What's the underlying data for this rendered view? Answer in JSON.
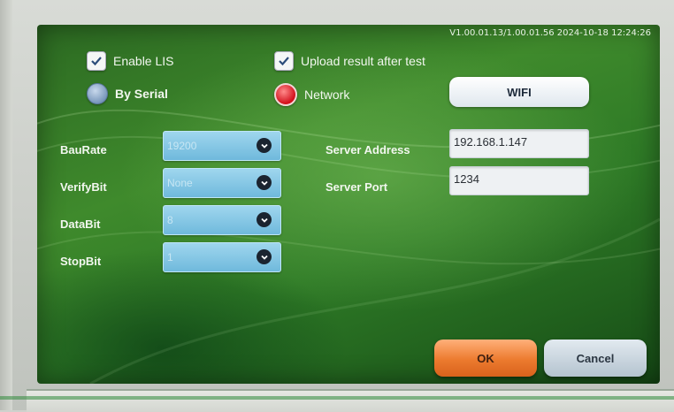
{
  "version_info": "V1.00.01.13/1.00.01.56  2024-10-18 12:24:26",
  "options": {
    "enable_lis": {
      "label": "Enable LIS",
      "checked": true
    },
    "upload_after_test": {
      "label": "Upload result after test",
      "checked": true
    }
  },
  "connection": {
    "by_serial": {
      "label": "By Serial",
      "selected": false
    },
    "network": {
      "label": "Network",
      "selected": true
    },
    "wifi_label": "WIFI"
  },
  "serial": {
    "baurate": {
      "label": "BauRate",
      "value": "19200"
    },
    "verifybit": {
      "label": "VerifyBit",
      "value": "None"
    },
    "databit": {
      "label": "DataBit",
      "value": "8"
    },
    "stopbit": {
      "label": "StopBit",
      "value": "1"
    }
  },
  "network": {
    "server_address": {
      "label": "Server Address",
      "value": "192.168.1.147"
    },
    "server_port": {
      "label": "Server Port",
      "value": "1234"
    }
  },
  "actions": {
    "ok_label": "OK",
    "cancel_label": "Cancel"
  },
  "colors": {
    "accent_ok": "#ec7a2e",
    "background": "#3f8a2c",
    "radio_on": "#d20e1a",
    "select_bg": "#6fb9dc"
  },
  "icons": {
    "checkbox": "checkmark-icon",
    "select_arrow": "chevron-down-icon"
  }
}
